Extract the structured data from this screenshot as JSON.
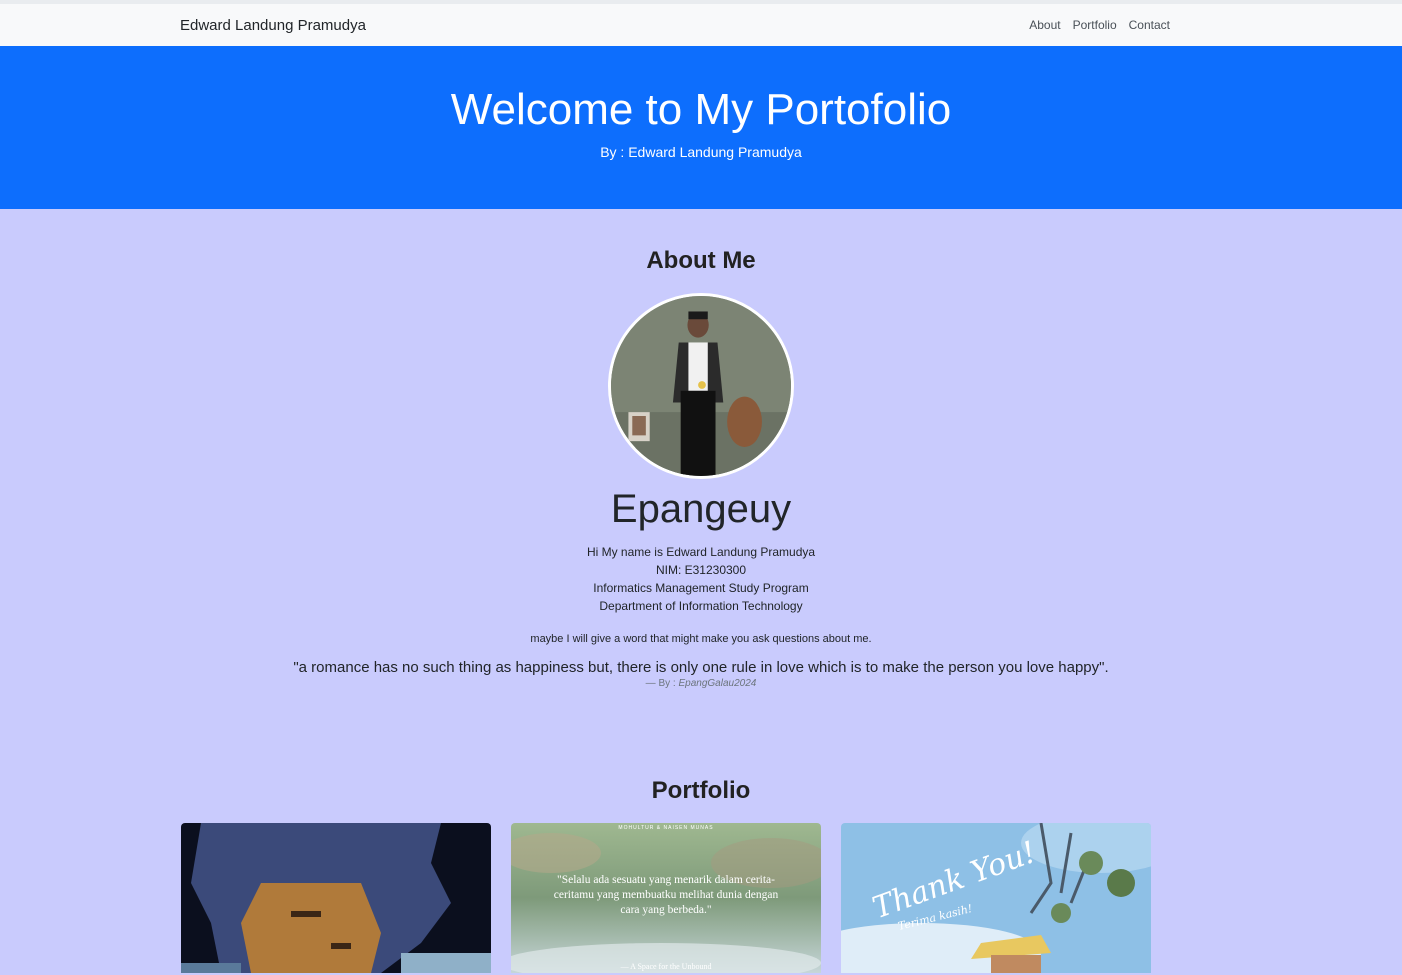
{
  "navbar": {
    "brand": "Edward Landung Pramudya",
    "links": [
      "About",
      "Portfolio",
      "Contact"
    ]
  },
  "hero": {
    "title": "Welcome to My Portofolio",
    "subtitle": "By : Edward Landung Pramudya"
  },
  "about": {
    "heading": "About Me",
    "nickname": "Epangeuy",
    "bio": [
      "Hi My name is Edward Landung Pramudya",
      "NIM: E31230300",
      "Informatics Management Study Program",
      "Department of Information Technology"
    ],
    "intro": "maybe I will give a word that might make you ask questions about me.",
    "quote": "\"a romance has no such thing as happiness but, there is only one rule in love which is to make the person you love happy\".",
    "quote_by_prefix": "— By : ",
    "quote_by_author": "EpangGalau2024"
  },
  "portfolio": {
    "heading": "Portfolio",
    "card2": {
      "top": "MOHULTUR & NAISEN MUNAS",
      "text": "\"Selalu ada sesuatu yang menarik dalam cerita-ceritamu yang membuatku melihat dunia dengan cara yang berbeda.\"",
      "credit": "— A Space for the Unbound"
    },
    "card3": {
      "title": "Thank You!",
      "subtitle": "Terima kasih!"
    }
  },
  "colors": {
    "hero": "#0d6efd",
    "page_background": "#c9cbfd",
    "navbar": "#f8f9fa"
  }
}
